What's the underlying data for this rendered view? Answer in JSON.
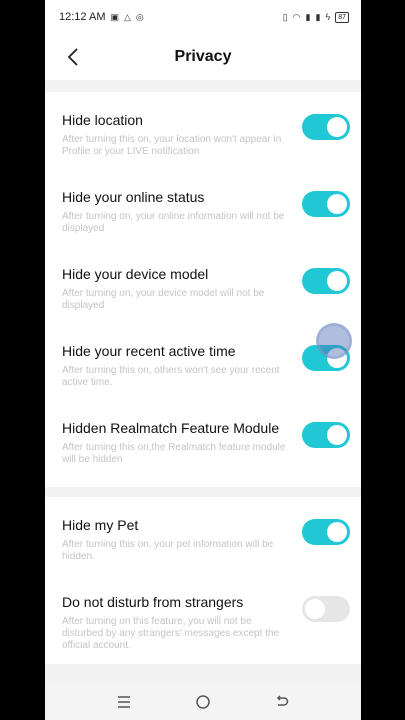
{
  "status": {
    "time": "12:12 AM",
    "battery": "87"
  },
  "header": {
    "title": "Privacy"
  },
  "colors": {
    "toggle_on": "#1fc8d4",
    "toggle_off": "#e6e6e6"
  },
  "settings": [
    {
      "label": "Hide location",
      "desc": "After turning this on, your location won't appear in Profile or your LIVE notification",
      "on": true
    },
    {
      "label": "Hide your online status",
      "desc": "After turning on, your online information will not be displayed",
      "on": true
    },
    {
      "label": "Hide your device model",
      "desc": "After turning on, your device model will not be displayed",
      "on": true
    },
    {
      "label": "Hide your recent active time",
      "desc": "After turning this on, others won't see your recent active time.",
      "on": true
    },
    {
      "label": "Hidden Realmatch Feature Module",
      "desc": "After turning this on,the Realmatch feature module will be hidden",
      "on": true
    }
  ],
  "settings2": [
    {
      "label": "Hide my Pet",
      "desc": "After turning this on, your pet information will be hidden.",
      "on": true
    },
    {
      "label": "Do not disturb from strangers",
      "desc": "After turning on this feature, you will not be disturbed by any strangers' messages except the official account.",
      "on": false
    }
  ],
  "navbar": {
    "icons": [
      "menu-icon",
      "home-circle-icon",
      "back-arrow-icon"
    ]
  }
}
